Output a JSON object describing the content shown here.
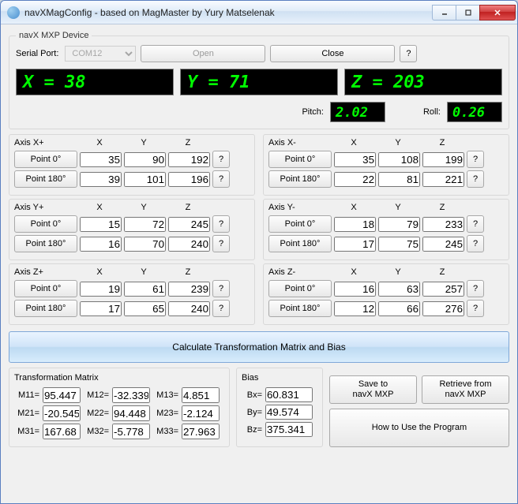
{
  "window": {
    "title": "navXMagConfig - based on MagMaster by Yury Matselenak"
  },
  "device": {
    "legend": "navX MXP Device",
    "serial_port_label": "Serial Port:",
    "serial_port_value": "COM12",
    "open_label": "Open",
    "close_label": "Close",
    "help_label": "?"
  },
  "readout": {
    "x": "X = 38",
    "y": "Y = 71",
    "z": "Z = 203",
    "pitch_label": "Pitch:",
    "pitch_value": "2.02",
    "roll_label": "Roll:",
    "roll_value": "0.26"
  },
  "col_labels": {
    "x": "X",
    "y": "Y",
    "z": "Z"
  },
  "point_labels": {
    "p0": "Point 0°",
    "p180": "Point 180°",
    "help": "?"
  },
  "axes": {
    "xp": {
      "label": "Axis X+",
      "p0": {
        "x": "35",
        "y": "90",
        "z": "192"
      },
      "p180": {
        "x": "39",
        "y": "101",
        "z": "196"
      }
    },
    "xm": {
      "label": "Axis X-",
      "p0": {
        "x": "35",
        "y": "108",
        "z": "199"
      },
      "p180": {
        "x": "22",
        "y": "81",
        "z": "221"
      }
    },
    "yp": {
      "label": "Axis Y+",
      "p0": {
        "x": "15",
        "y": "72",
        "z": "245"
      },
      "p180": {
        "x": "16",
        "y": "70",
        "z": "240"
      }
    },
    "ym": {
      "label": "Axis Y-",
      "p0": {
        "x": "18",
        "y": "79",
        "z": "233"
      },
      "p180": {
        "x": "17",
        "y": "75",
        "z": "245"
      }
    },
    "zp": {
      "label": "Axis Z+",
      "p0": {
        "x": "19",
        "y": "61",
        "z": "239"
      },
      "p180": {
        "x": "17",
        "y": "65",
        "z": "240"
      }
    },
    "zm": {
      "label": "Axis Z-",
      "p0": {
        "x": "16",
        "y": "63",
        "z": "257"
      },
      "p180": {
        "x": "12",
        "y": "66",
        "z": "276"
      }
    }
  },
  "calc_label": "Calculate Transformation Matrix and Bias",
  "matrix": {
    "legend": "Transformation Matrix",
    "m11_l": "M11=",
    "m11": "95.447",
    "m12_l": "M12=",
    "m12": "-32.339",
    "m13_l": "M13=",
    "m13": "4.851",
    "m21_l": "M21=",
    "m21": "-20.545",
    "m22_l": "M22=",
    "m22": "94.448",
    "m23_l": "M23=",
    "m23": "-2.124",
    "m31_l": "M31=",
    "m31": "167.68",
    "m32_l": "M32=",
    "m32": "-5.778",
    "m33_l": "M33=",
    "m33": "27.963"
  },
  "bias": {
    "legend": "Bias",
    "bx_l": "Bx=",
    "bx": "60.831",
    "by_l": "By=",
    "by": "49.574",
    "bz_l": "Bz=",
    "bz": "375.341"
  },
  "actions": {
    "save": "Save to\nnavX MXP",
    "retrieve": "Retrieve from\nnavX MXP",
    "howto": "How to Use the Program"
  }
}
